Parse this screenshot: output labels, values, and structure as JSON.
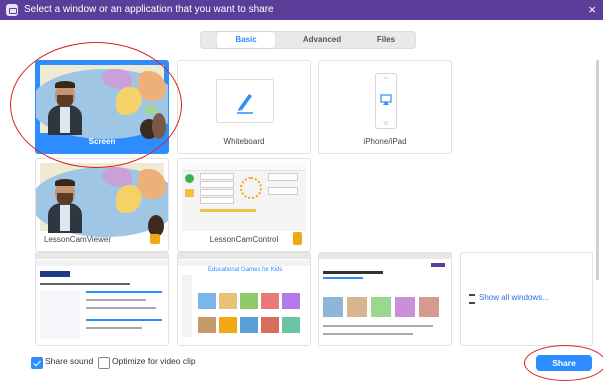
{
  "title_bar": {
    "title": "Select a window or an application that you want to share",
    "close_glyph": "×"
  },
  "tabs": [
    {
      "label": "Basic",
      "selected": true
    },
    {
      "label": "Advanced",
      "selected": false
    },
    {
      "label": "Files",
      "selected": false
    }
  ],
  "tiles": [
    {
      "label": "Screen",
      "selected": true
    },
    {
      "label": "Whiteboard",
      "selected": false
    },
    {
      "label": "iPhone/iPad",
      "selected": false
    },
    {
      "label": "LessonCamViewer",
      "selected": false
    },
    {
      "label": "LessonCamControl",
      "selected": false
    }
  ],
  "window_thumbnails": [
    {
      "header": "Educational Games for Kids"
    }
  ],
  "show_all": {
    "label": "Show all windows..."
  },
  "bottom": {
    "share_sound": {
      "label": "Share sound",
      "checked": true
    },
    "optimize_video": {
      "label": "Optimize for video clip",
      "checked": false
    },
    "share_button": "Share"
  },
  "colors": {
    "title_bar": "#5a3e99",
    "accent": "#2d8cff",
    "annotation": "#d92020"
  },
  "icons": [
    "zoom-share-icon",
    "close-icon",
    "pencil-icon",
    "airplay-icon",
    "stack-icon",
    "checkbox-icon"
  ]
}
